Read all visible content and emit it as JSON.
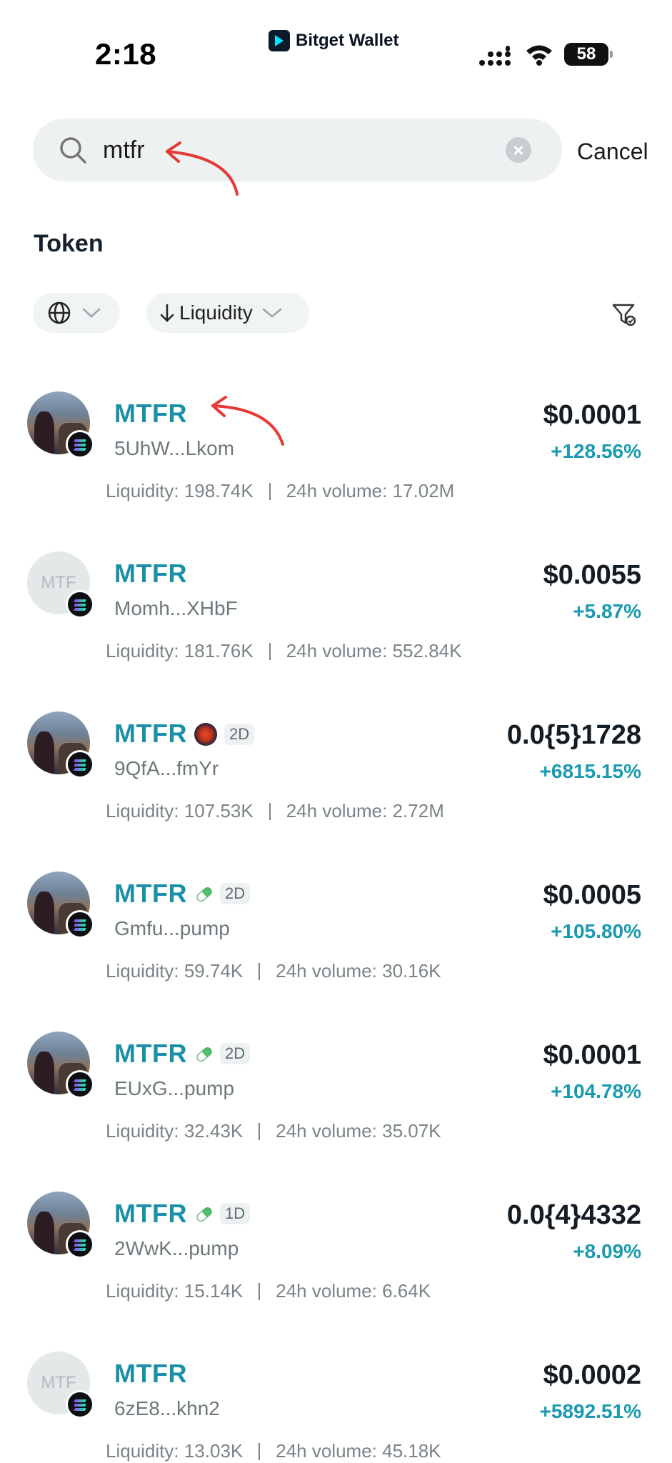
{
  "status_bar": {
    "time": "2:18",
    "battery": "58",
    "brand": "Bitget Wallet"
  },
  "search": {
    "query": "mtfr",
    "cancel_label": "Cancel"
  },
  "section": {
    "title": "Token"
  },
  "filters": {
    "sort_label": "Liquidity"
  },
  "colors": {
    "accent": "#1a8fa8",
    "change_positive": "#1a9ab0",
    "annotation": "#e53935"
  },
  "tokens": [
    {
      "symbol": "MTFR",
      "address": "5UhW...Lkom",
      "price": "$0.0001",
      "change": "+128.56%",
      "liquidity": "Liquidity: 198.74K",
      "volume": "24h volume: 17.02M",
      "avatar": "photo",
      "avatar_text": ""
    },
    {
      "symbol": "MTFR",
      "address": "Momh...XHbF",
      "price": "$0.0055",
      "change": "+5.87%",
      "liquidity": "Liquidity: 181.76K",
      "volume": "24h volume: 552.84K",
      "avatar": "placeholder",
      "avatar_text": "MTF"
    },
    {
      "symbol": "MTFR",
      "address": "9QfA...fmYr",
      "price": "0.0{5}1728",
      "change": "+6815.15%",
      "liquidity": "Liquidity: 107.53K",
      "volume": "24h volume: 2.72M",
      "avatar": "photo",
      "avatar_text": "",
      "tag_icon": "launchpad-icon",
      "age": "2D"
    },
    {
      "symbol": "MTFR",
      "address": "Gmfu...pump",
      "price": "$0.0005",
      "change": "+105.80%",
      "liquidity": "Liquidity: 59.74K",
      "volume": "24h volume: 30.16K",
      "avatar": "photo",
      "avatar_text": "",
      "tag_icon": "pill-icon",
      "age": "2D"
    },
    {
      "symbol": "MTFR",
      "address": "EUxG...pump",
      "price": "$0.0001",
      "change": "+104.78%",
      "liquidity": "Liquidity: 32.43K",
      "volume": "24h volume: 35.07K",
      "avatar": "photo",
      "avatar_text": "",
      "tag_icon": "pill-icon",
      "age": "2D"
    },
    {
      "symbol": "MTFR",
      "address": "2WwK...pump",
      "price": "0.0{4}4332",
      "change": "+8.09%",
      "liquidity": "Liquidity: 15.14K",
      "volume": "24h volume: 6.64K",
      "avatar": "photo",
      "avatar_text": "",
      "tag_icon": "pill-icon",
      "age": "1D"
    },
    {
      "symbol": "MTFR",
      "address": "6zE8...khn2",
      "price": "$0.0002",
      "change": "+5892.51%",
      "liquidity": "Liquidity: 13.03K",
      "volume": "24h volume: 45.18K",
      "avatar": "placeholder",
      "avatar_text": "MTF"
    }
  ]
}
